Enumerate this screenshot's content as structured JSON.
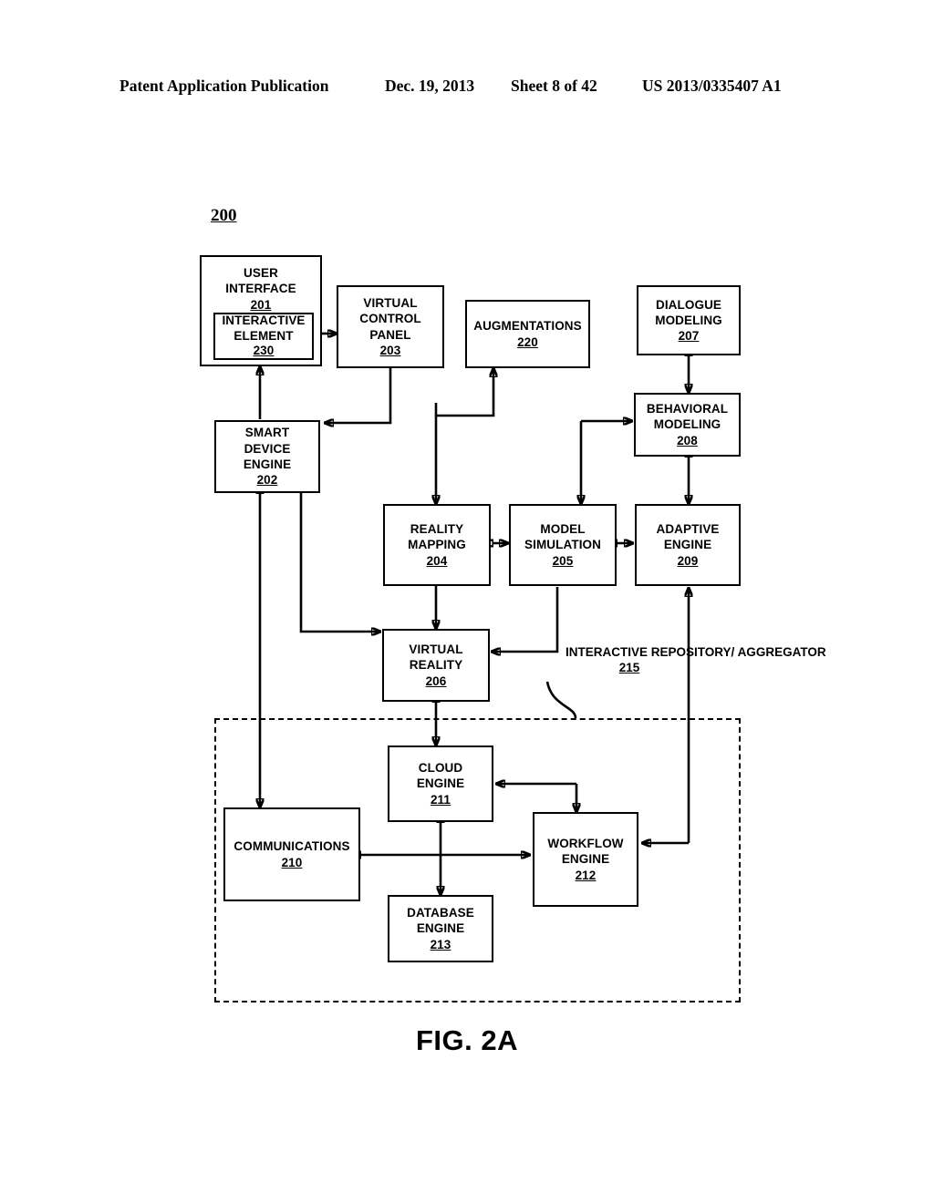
{
  "header": {
    "publication": "Patent Application Publication",
    "date": "Dec. 19, 2013",
    "sheet": "Sheet 8 of 42",
    "patent_number": "US 2013/0335407 A1"
  },
  "figure": {
    "system_ref": "200",
    "caption": "FIG. 2A"
  },
  "blocks": {
    "user_interface": {
      "line1": "USER",
      "line2": "INTERFACE",
      "ref": "201"
    },
    "interactive_element": {
      "line1": "INTERACTIVE",
      "line2": "ELEMENT",
      "ref": "230"
    },
    "virtual_control_panel": {
      "line1": "VIRTUAL",
      "line2": "CONTROL",
      "line3": "PANEL",
      "ref": "203"
    },
    "augmentations": {
      "line1": "AUGMENTATIONS",
      "ref": "220"
    },
    "dialogue_modeling": {
      "line1": "DIALOGUE",
      "line2": "MODELING",
      "ref": "207"
    },
    "smart_device_engine": {
      "line1": "SMART",
      "line2": "DEVICE",
      "line3": "ENGINE",
      "ref": "202"
    },
    "behavioral_modeling": {
      "line1": "BEHAVIORAL",
      "line2": "MODELING",
      "ref": "208"
    },
    "reality_mapping": {
      "line1": "REALITY",
      "line2": "MAPPING",
      "ref": "204"
    },
    "model_simulation": {
      "line1": "MODEL",
      "line2": "SIMULATION",
      "ref": "205"
    },
    "adaptive_engine": {
      "line1": "ADAPTIVE",
      "line2": "ENGINE",
      "ref": "209"
    },
    "virtual_reality": {
      "line1": "VIRTUAL",
      "line2": "REALITY",
      "ref": "206"
    },
    "interactive_repository": {
      "line1": "INTERACTIVE",
      "line2": "REPOSITORY/",
      "line3": "AGGREGATOR",
      "ref": "215"
    },
    "cloud_engine": {
      "line1": "CLOUD",
      "line2": "ENGINE",
      "ref": "211"
    },
    "communications": {
      "line1": "COMMUNICATIONS",
      "ref": "210"
    },
    "workflow_engine": {
      "line1": "WORKFLOW",
      "line2": "ENGINE",
      "ref": "212"
    },
    "database_engine": {
      "line1": "DATABASE",
      "line2": "ENGINE",
      "ref": "213"
    }
  }
}
